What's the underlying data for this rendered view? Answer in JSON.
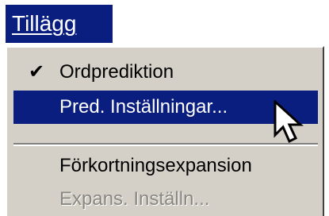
{
  "menubar": {
    "title": "Tillägg"
  },
  "menu": {
    "items": [
      {
        "label": "Ordprediktion",
        "checked": true,
        "check_glyph": "✔"
      },
      {
        "label": "Pred. Inställningar...",
        "highlighted": true
      },
      {
        "label": "Förkortningsexpansion"
      },
      {
        "label": "Expans. Inställn...",
        "disabled": true
      }
    ]
  },
  "cursor": {
    "icon": "arrow-pointer-icon"
  },
  "colors": {
    "highlight": "#0a1e80",
    "menu_background": "#d4d0c8",
    "disabled_text": "#8a8780"
  }
}
